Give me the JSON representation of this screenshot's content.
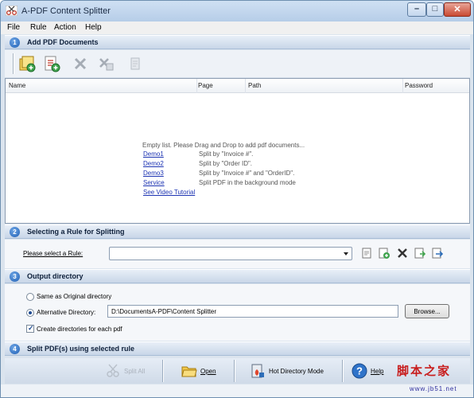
{
  "window": {
    "title": "A-PDF Content Splitter",
    "controls": {
      "minimize": "–",
      "maximize": "□",
      "close": "✕"
    }
  },
  "menu": [
    "File",
    "Rule",
    "Action",
    "Help"
  ],
  "sections": {
    "s1": {
      "num": "1",
      "title": "Add PDF Documents"
    },
    "s2": {
      "num": "2",
      "title": "Selecting a Rule for Splitting"
    },
    "s3": {
      "num": "3",
      "title": "Output directory"
    },
    "s4": {
      "num": "4",
      "title": "Split PDF(s) using selected rule"
    }
  },
  "toolbar_icons": [
    "add-files-icon",
    "add-folder-icon",
    "remove-icon",
    "remove-all-icon",
    "settings-icon"
  ],
  "list": {
    "columns": [
      "Name",
      "Page",
      "Path",
      "Password"
    ],
    "empty_message": "Empty list. Please Drag and Drop to add pdf documents...",
    "demos": [
      {
        "link": "Demo1",
        "desc": "Split by \"Invoice #\"."
      },
      {
        "link": "Demo2",
        "desc": "Split by \"Order ID\"."
      },
      {
        "link": "Demo3",
        "desc": "Split by \"Invoice #\" and \"OrderID\"."
      },
      {
        "link": "Service",
        "desc": "Split PDF in the background mode"
      }
    ],
    "video_link": "See Video Tutorial"
  },
  "rule": {
    "label": "Please select a Rule:",
    "selected": "",
    "icons": [
      "rule-view-icon",
      "rule-add-icon",
      "rule-delete-icon",
      "rule-import-icon",
      "rule-export-icon"
    ]
  },
  "output": {
    "option_original": "Same as Original directory",
    "option_alternative": "Alternative Directory:",
    "selected_option": "alternative",
    "directory": "D:\\DocumentsA-PDF\\Content Splitter",
    "browse": "Browse...",
    "create_dirs_label": "Create directories for each pdf",
    "create_dirs_checked": true
  },
  "actions": {
    "split": "Split All",
    "open": "Open",
    "hot_directory": "Hot Directory Mode",
    "help": "Help"
  },
  "watermark": {
    "title": "脚本之家",
    "url": "www.jb51.net"
  },
  "colors": {
    "accent": "#1f5fb4",
    "link": "#1d34b3",
    "watermark": "#c81d1d"
  }
}
